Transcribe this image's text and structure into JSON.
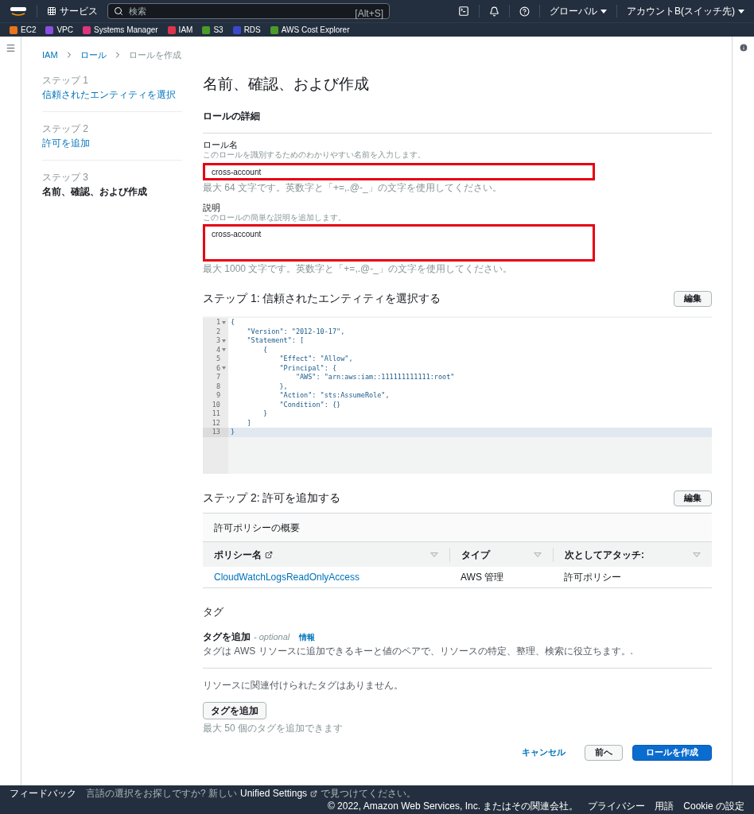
{
  "top_nav": {
    "services": "サービス",
    "search_placeholder": "検索",
    "shortcut": "[Alt+S]",
    "region": "グローバル",
    "account": "アカウントB(スイッチ先)"
  },
  "favorites": [
    {
      "label": "EC2",
      "color": "#e8761a"
    },
    {
      "label": "VPC",
      "color": "#8a4fe0"
    },
    {
      "label": "Systems Manager",
      "color": "#e0357a"
    },
    {
      "label": "IAM",
      "color": "#dd344c"
    },
    {
      "label": "S3",
      "color": "#4b9a2a"
    },
    {
      "label": "RDS",
      "color": "#3b48cc"
    },
    {
      "label": "AWS Cost Explorer",
      "color": "#4b9a2a"
    }
  ],
  "breadcrumb": [
    {
      "label": "IAM",
      "link": true
    },
    {
      "label": "ロール",
      "link": true
    },
    {
      "label": "ロールを作成",
      "link": false
    }
  ],
  "steps": [
    {
      "step": "ステップ 1",
      "label": "信頼されたエンティティを選択",
      "selected": false
    },
    {
      "step": "ステップ 2",
      "label": "許可を追加",
      "selected": false
    },
    {
      "step": "ステップ 3",
      "label": "名前、確認、および作成",
      "selected": true
    }
  ],
  "page_title": "名前、確認、および作成",
  "details": {
    "title": "ロールの詳細",
    "fields": [
      {
        "kind": "input",
        "label": "ロール名",
        "hint": "このロールを識別するためのわかりやすい名前を入力します。",
        "value": "cross-account",
        "constraint": "最大 64 文字です。英数字と「+=,.@-_」の文字を使用してください。",
        "highlighted": true
      },
      {
        "kind": "textarea",
        "label": "説明",
        "hint": "このロールの簡単な説明を追加します。",
        "value": "cross-account",
        "constraint": "最大 1000 文字です。英数字と「+=,.@-_」の文字を使用してください。",
        "highlighted": true
      }
    ]
  },
  "step1": {
    "title": "ステップ 1: 信頼されたエンティティを選択する",
    "edit": "編集",
    "code": [
      {
        "number": "1",
        "text": "{",
        "fold": true,
        "current": false
      },
      {
        "number": "2",
        "text": "    \"Version\": \"2012-10-17\",",
        "fold": false,
        "current": false
      },
      {
        "number": "3",
        "text": "    \"Statement\": [",
        "fold": true,
        "current": false
      },
      {
        "number": "4",
        "text": "        {",
        "fold": true,
        "current": false
      },
      {
        "number": "5",
        "text": "            \"Effect\": \"Allow\",",
        "fold": false,
        "current": false
      },
      {
        "number": "6",
        "text": "            \"Principal\": {",
        "fold": true,
        "current": false
      },
      {
        "number": "7",
        "text": "                \"AWS\": \"arn:aws:iam::111111111111:root\"",
        "fold": false,
        "current": false
      },
      {
        "number": "8",
        "text": "            },",
        "fold": false,
        "current": false
      },
      {
        "number": "9",
        "text": "            \"Action\": \"sts:AssumeRole\",",
        "fold": false,
        "current": false
      },
      {
        "number": "10",
        "text": "            \"Condition\": {}",
        "fold": false,
        "current": false
      },
      {
        "number": "11",
        "text": "        }",
        "fold": false,
        "current": false
      },
      {
        "number": "12",
        "text": "    ]",
        "fold": false,
        "current": false
      },
      {
        "number": "13",
        "text": "}",
        "fold": false,
        "current": true
      }
    ]
  },
  "step2": {
    "title": "ステップ 2: 許可を追加する",
    "edit": "編集",
    "table_title": "許可ポリシーの概要",
    "columns": [
      {
        "label": "ポリシー名",
        "external": true
      },
      {
        "label": "タイプ",
        "external": false
      },
      {
        "label": "次としてアタッチ:",
        "external": false
      }
    ],
    "rows": [
      [
        "CloudWatchLogsReadOnlyAccess",
        "AWS 管理",
        "許可ポリシー"
      ]
    ]
  },
  "tags": {
    "title": "タグ",
    "subtitle": "タグを追加",
    "optional": "- optional",
    "info": "情報",
    "description": "タグは AWS リソースに追加できるキーと値のペアで、リソースの特定、整理、検索に役立ちます。.",
    "empty": "リソースに関連付けられたタグはありません。",
    "add_button": "タグを追加",
    "limit": "最大 50 個のタグを追加できます"
  },
  "actions": {
    "cancel": "キャンセル",
    "previous": "前へ",
    "create": "ロールを作成"
  },
  "footer": {
    "feedback": "フィードバック",
    "lang_prefix": "言語の選択をお探しですか? 新しい",
    "lang_link": "Unified Settings",
    "lang_suffix": "で見つけてください。",
    "copyright": "© 2022, Amazon Web Services, Inc. またはその関連会社。",
    "links": [
      "プライバシー",
      "用語",
      "Cookie の設定"
    ]
  }
}
